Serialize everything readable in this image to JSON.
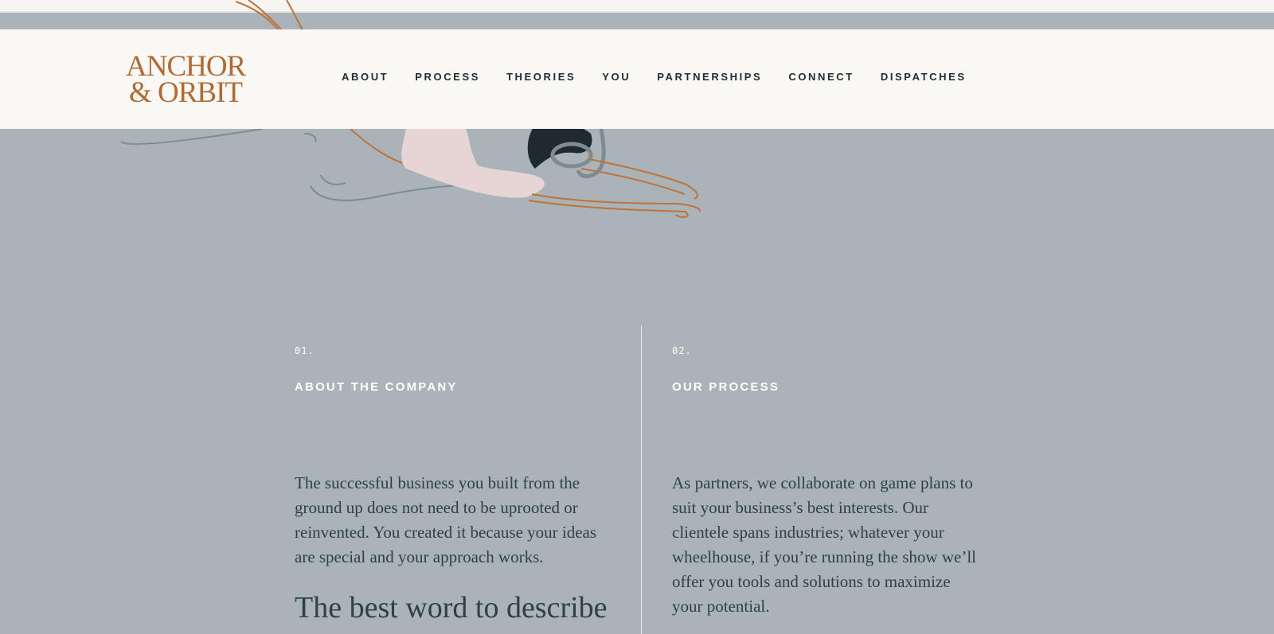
{
  "logo": {
    "line1": "ANCHOR",
    "line2": "& ORBIT"
  },
  "nav": [
    {
      "label": "ABOUT"
    },
    {
      "label": "PROCESS"
    },
    {
      "label": "THEORIES"
    },
    {
      "label": "YOU"
    },
    {
      "label": "PARTNERSHIPS"
    },
    {
      "label": "CONNECT"
    },
    {
      "label": "DISPATCHES"
    }
  ],
  "sections": [
    {
      "number": "01.",
      "heading": "ABOUT THE COMPANY",
      "body": "The successful business you built from the ground up does not need to be uprooted or reinvented. You created it because your ideas are special and your approach works.",
      "large": "The best word to describe"
    },
    {
      "number": "02.",
      "heading": "OUR PROCESS",
      "body": "As partners, we collaborate on game plans to suit your business’s best interests. Our clientele spans industries; whatever your wheelhouse, if you’re running the show we’ll offer you tools and solutions to maximize your potential."
    }
  ],
  "colors": {
    "background": "#a9b3b8",
    "header": "#f9f8f5",
    "brand": "#b06b34",
    "nav_text": "#1e2c33",
    "body_text": "#2f4148"
  }
}
